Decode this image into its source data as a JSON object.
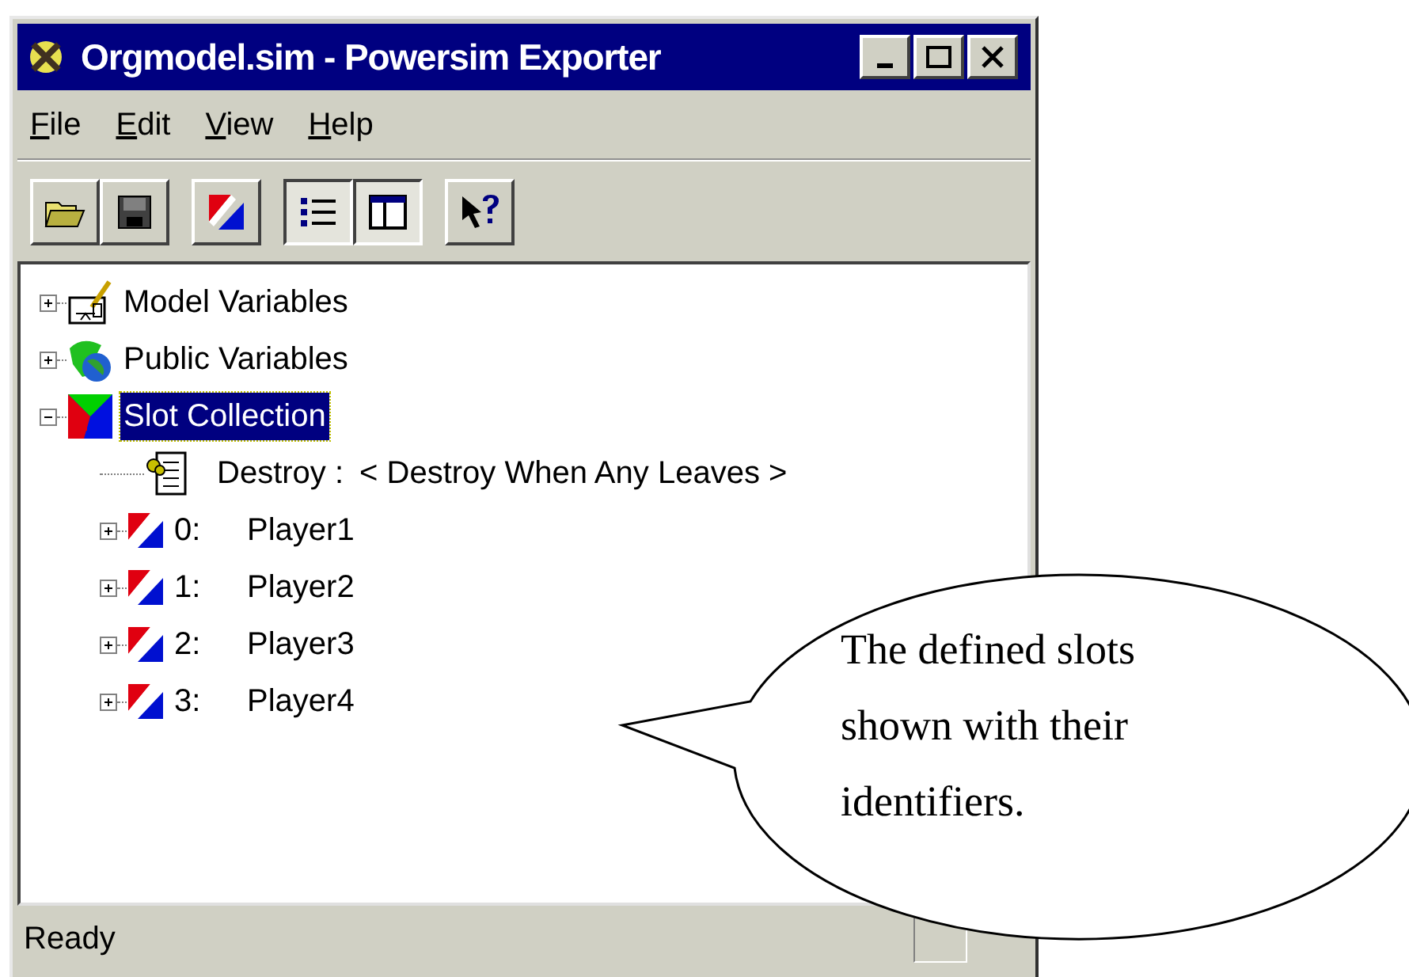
{
  "window": {
    "title": "Orgmodel.sim - Powersim Exporter"
  },
  "menu": [
    {
      "label": "File"
    },
    {
      "label": "Edit"
    },
    {
      "label": "View"
    },
    {
      "label": "Help"
    }
  ],
  "toolbar": [
    {
      "kind": "open",
      "pressed": false
    },
    {
      "kind": "save",
      "pressed": false
    },
    {
      "kind": "slot",
      "pressed": false
    },
    {
      "kind": "list",
      "pressed": true
    },
    {
      "kind": "panes",
      "pressed": true
    },
    {
      "kind": "help",
      "pressed": false
    }
  ],
  "tree": [
    {
      "kind": "model",
      "label": "Model Variables",
      "expanded": false,
      "selected": false
    },
    {
      "kind": "public",
      "label": "Public Variables",
      "expanded": false,
      "selected": false
    },
    {
      "kind": "collection",
      "label": "Slot Collection",
      "expanded": true,
      "selected": true,
      "children": [
        {
          "kind": "property",
          "name": "Destroy :",
          "value": "< Destroy When Any Leaves >"
        },
        {
          "kind": "slot",
          "index": "0:",
          "label": "Player1",
          "expanded": false,
          "selected": false
        },
        {
          "kind": "slot",
          "index": "1:",
          "label": "Player2",
          "expanded": false,
          "selected": false
        },
        {
          "kind": "slot",
          "index": "2:",
          "label": "Player3",
          "expanded": false,
          "selected": false
        },
        {
          "kind": "slot",
          "index": "3:",
          "label": "Player4",
          "expanded": false,
          "selected": false
        }
      ]
    }
  ],
  "status_bar": {
    "text": "Ready"
  },
  "callout": {
    "text": "The defined slots shown with their identifiers."
  }
}
